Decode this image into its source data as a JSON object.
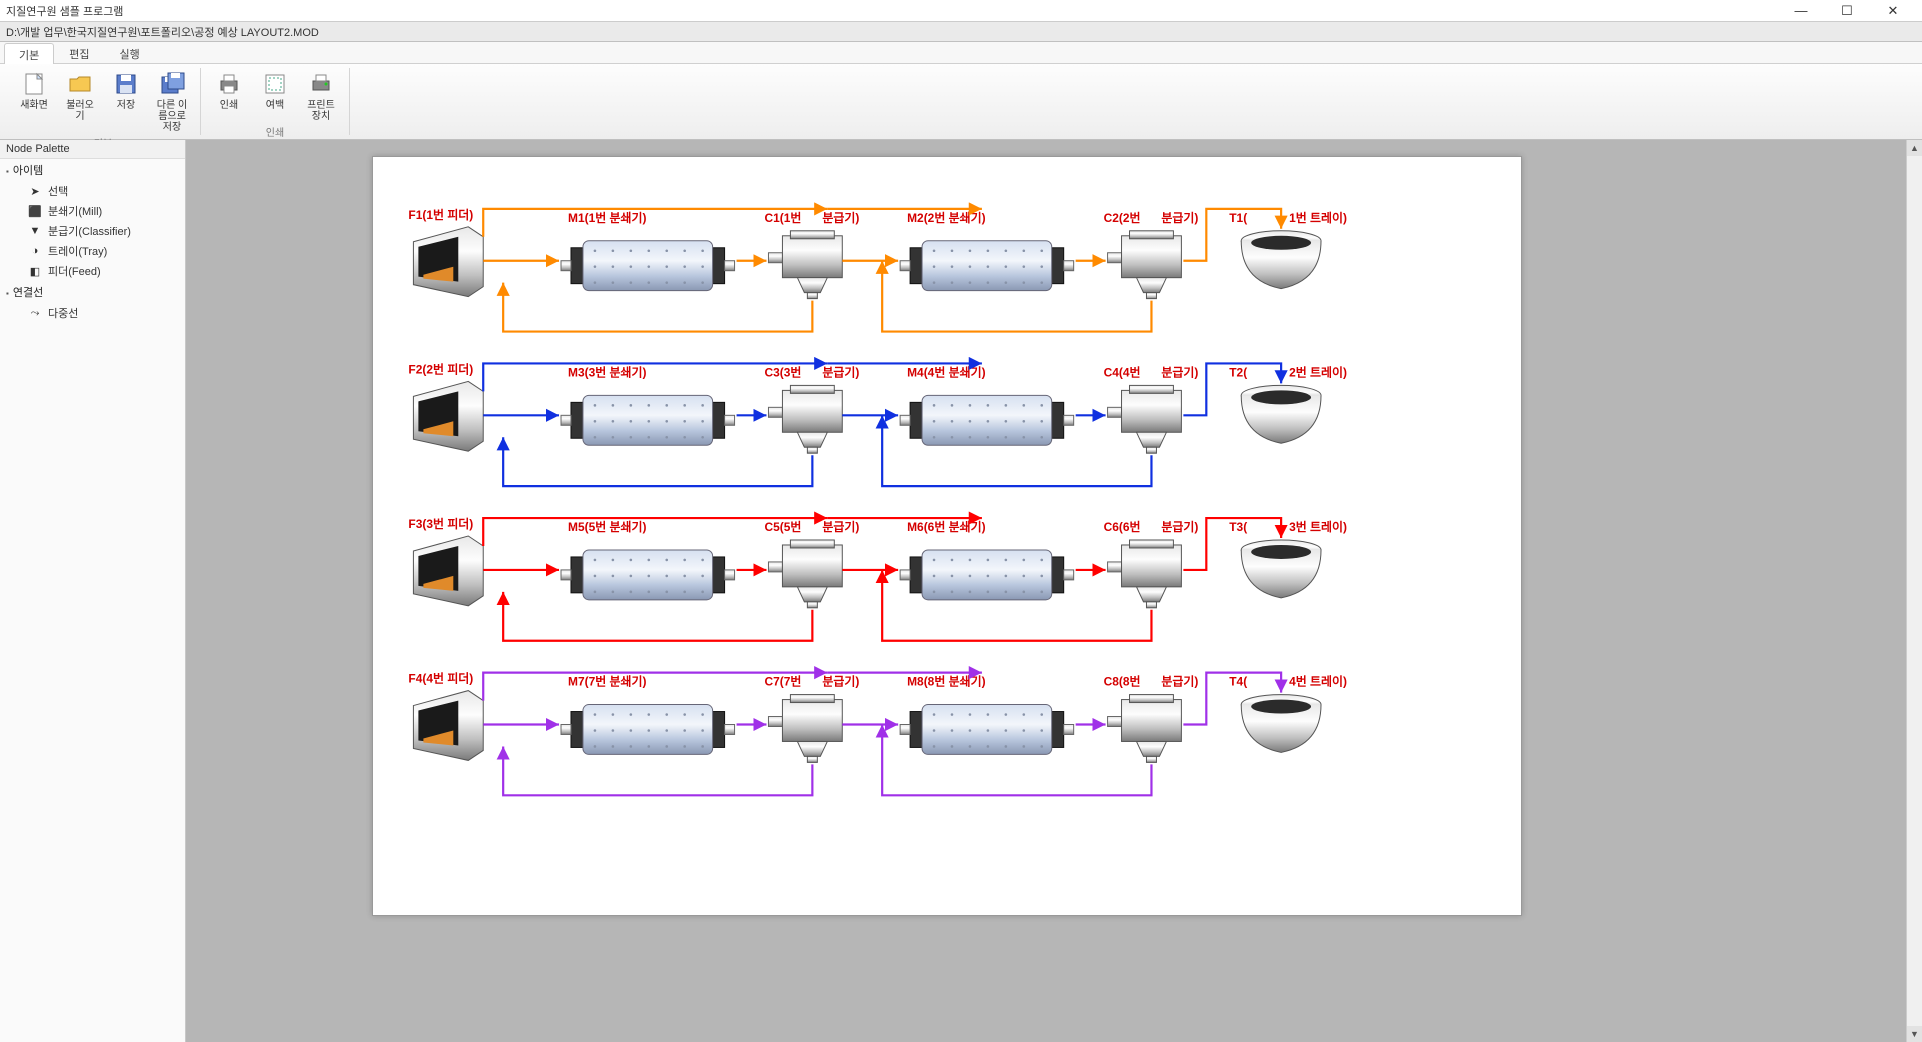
{
  "window": {
    "title": "지질연구원 샘플 프로그램"
  },
  "pathbar": "D:\\개발 업무\\한국지질연구원\\포트폴리오\\공정 예상 LAYOUT2.MOD",
  "ribbon": {
    "tabs": [
      {
        "label": "기본",
        "active": true
      },
      {
        "label": "편집",
        "active": false
      },
      {
        "label": "실행",
        "active": false
      }
    ],
    "groups": [
      {
        "caption": "기본",
        "buttons": [
          {
            "label": "새화면",
            "icon": "new-doc-icon"
          },
          {
            "label": "불러오기",
            "icon": "open-folder-icon"
          },
          {
            "label": "저장",
            "icon": "save-icon"
          },
          {
            "label": "다른 이름으로 저장",
            "icon": "saveas-icon"
          }
        ]
      },
      {
        "caption": "인쇄",
        "buttons": [
          {
            "label": "인쇄",
            "icon": "print-icon"
          },
          {
            "label": "여백",
            "icon": "margin-icon"
          },
          {
            "label": "프린트 장치",
            "icon": "printer-icon"
          }
        ]
      }
    ]
  },
  "palette": {
    "title": "Node Palette",
    "groups": [
      {
        "label": "아이템",
        "items": [
          {
            "label": "선택",
            "icon": "cursor-icon"
          },
          {
            "label": "분쇄기(Mill)",
            "icon": "mill-icon"
          },
          {
            "label": "분급기(Classifier)",
            "icon": "classifier-icon"
          },
          {
            "label": "트레이(Tray)",
            "icon": "tray-icon"
          },
          {
            "label": "피더(Feed)",
            "icon": "feed-icon"
          }
        ]
      },
      {
        "label": "연결선",
        "items": [
          {
            "label": "다중선",
            "icon": "polyline-icon"
          }
        ]
      }
    ]
  },
  "rows": [
    {
      "color": "#ff8a00",
      "feeder": "F1(1번 피더)",
      "m1": "M1(1번 분쇄기)",
      "c1": "C1(1번",
      "c1b": "분급기)",
      "m2": "M2(2번 분쇄기)",
      "c2": "C2(2번",
      "c2b": "분급기)",
      "tray": "T1(",
      "trayb": "1번 트레이)"
    },
    {
      "color": "#1030e0",
      "feeder": "F2(2번 피더)",
      "m1": "M3(3번 분쇄기)",
      "c1": "C3(3번",
      "c1b": "분급기)",
      "m2": "M4(4번 분쇄기)",
      "c2": "C4(4번",
      "c2b": "분급기)",
      "tray": "T2(",
      "trayb": "2번 트레이)"
    },
    {
      "color": "#ff0000",
      "feeder": "F3(3번 피더)",
      "m1": "M5(5번 분쇄기)",
      "c1": "C5(5번",
      "c1b": "분급기)",
      "m2": "M6(6번 분쇄기)",
      "c2": "C6(6번",
      "c2b": "분급기)",
      "tray": "T3(",
      "trayb": "3번 트레이)"
    },
    {
      "color": "#a030e8",
      "feeder": "F4(4번 피더)",
      "m1": "M7(7번 분쇄기)",
      "c1": "C7(7번",
      "c1b": "분급기)",
      "m2": "M8(8번 분쇄기)",
      "c2": "C8(8번",
      "c2b": "분급기)",
      "tray": "T4(",
      "trayb": "4번 트레이)"
    }
  ]
}
